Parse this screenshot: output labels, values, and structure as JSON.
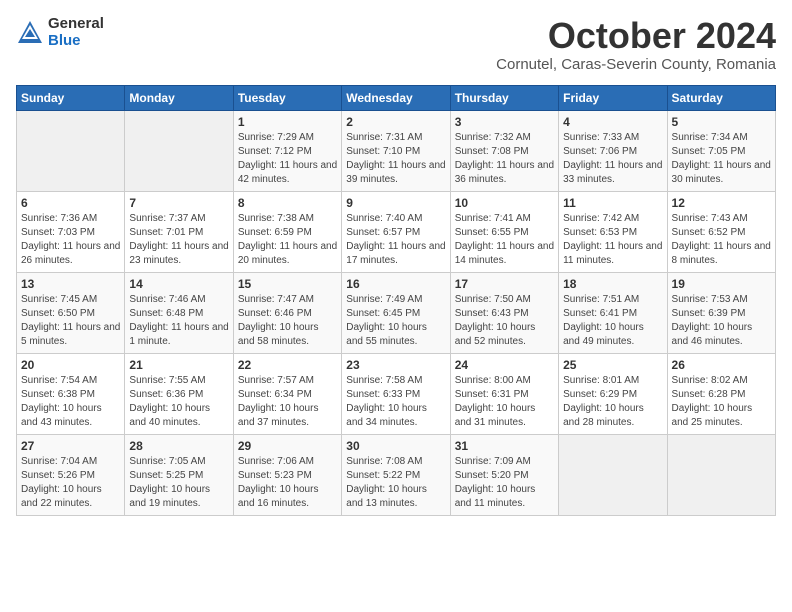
{
  "logo": {
    "general": "General",
    "blue": "Blue"
  },
  "title": {
    "month": "October 2024",
    "location": "Cornutel, Caras-Severin County, Romania"
  },
  "weekdays": [
    "Sunday",
    "Monday",
    "Tuesday",
    "Wednesday",
    "Thursday",
    "Friday",
    "Saturday"
  ],
  "weeks": [
    [
      {
        "day": "",
        "info": ""
      },
      {
        "day": "",
        "info": ""
      },
      {
        "day": "1",
        "info": "Sunrise: 7:29 AM\nSunset: 7:12 PM\nDaylight: 11 hours and 42 minutes."
      },
      {
        "day": "2",
        "info": "Sunrise: 7:31 AM\nSunset: 7:10 PM\nDaylight: 11 hours and 39 minutes."
      },
      {
        "day": "3",
        "info": "Sunrise: 7:32 AM\nSunset: 7:08 PM\nDaylight: 11 hours and 36 minutes."
      },
      {
        "day": "4",
        "info": "Sunrise: 7:33 AM\nSunset: 7:06 PM\nDaylight: 11 hours and 33 minutes."
      },
      {
        "day": "5",
        "info": "Sunrise: 7:34 AM\nSunset: 7:05 PM\nDaylight: 11 hours and 30 minutes."
      }
    ],
    [
      {
        "day": "6",
        "info": "Sunrise: 7:36 AM\nSunset: 7:03 PM\nDaylight: 11 hours and 26 minutes."
      },
      {
        "day": "7",
        "info": "Sunrise: 7:37 AM\nSunset: 7:01 PM\nDaylight: 11 hours and 23 minutes."
      },
      {
        "day": "8",
        "info": "Sunrise: 7:38 AM\nSunset: 6:59 PM\nDaylight: 11 hours and 20 minutes."
      },
      {
        "day": "9",
        "info": "Sunrise: 7:40 AM\nSunset: 6:57 PM\nDaylight: 11 hours and 17 minutes."
      },
      {
        "day": "10",
        "info": "Sunrise: 7:41 AM\nSunset: 6:55 PM\nDaylight: 11 hours and 14 minutes."
      },
      {
        "day": "11",
        "info": "Sunrise: 7:42 AM\nSunset: 6:53 PM\nDaylight: 11 hours and 11 minutes."
      },
      {
        "day": "12",
        "info": "Sunrise: 7:43 AM\nSunset: 6:52 PM\nDaylight: 11 hours and 8 minutes."
      }
    ],
    [
      {
        "day": "13",
        "info": "Sunrise: 7:45 AM\nSunset: 6:50 PM\nDaylight: 11 hours and 5 minutes."
      },
      {
        "day": "14",
        "info": "Sunrise: 7:46 AM\nSunset: 6:48 PM\nDaylight: 11 hours and 1 minute."
      },
      {
        "day": "15",
        "info": "Sunrise: 7:47 AM\nSunset: 6:46 PM\nDaylight: 10 hours and 58 minutes."
      },
      {
        "day": "16",
        "info": "Sunrise: 7:49 AM\nSunset: 6:45 PM\nDaylight: 10 hours and 55 minutes."
      },
      {
        "day": "17",
        "info": "Sunrise: 7:50 AM\nSunset: 6:43 PM\nDaylight: 10 hours and 52 minutes."
      },
      {
        "day": "18",
        "info": "Sunrise: 7:51 AM\nSunset: 6:41 PM\nDaylight: 10 hours and 49 minutes."
      },
      {
        "day": "19",
        "info": "Sunrise: 7:53 AM\nSunset: 6:39 PM\nDaylight: 10 hours and 46 minutes."
      }
    ],
    [
      {
        "day": "20",
        "info": "Sunrise: 7:54 AM\nSunset: 6:38 PM\nDaylight: 10 hours and 43 minutes."
      },
      {
        "day": "21",
        "info": "Sunrise: 7:55 AM\nSunset: 6:36 PM\nDaylight: 10 hours and 40 minutes."
      },
      {
        "day": "22",
        "info": "Sunrise: 7:57 AM\nSunset: 6:34 PM\nDaylight: 10 hours and 37 minutes."
      },
      {
        "day": "23",
        "info": "Sunrise: 7:58 AM\nSunset: 6:33 PM\nDaylight: 10 hours and 34 minutes."
      },
      {
        "day": "24",
        "info": "Sunrise: 8:00 AM\nSunset: 6:31 PM\nDaylight: 10 hours and 31 minutes."
      },
      {
        "day": "25",
        "info": "Sunrise: 8:01 AM\nSunset: 6:29 PM\nDaylight: 10 hours and 28 minutes."
      },
      {
        "day": "26",
        "info": "Sunrise: 8:02 AM\nSunset: 6:28 PM\nDaylight: 10 hours and 25 minutes."
      }
    ],
    [
      {
        "day": "27",
        "info": "Sunrise: 7:04 AM\nSunset: 5:26 PM\nDaylight: 10 hours and 22 minutes."
      },
      {
        "day": "28",
        "info": "Sunrise: 7:05 AM\nSunset: 5:25 PM\nDaylight: 10 hours and 19 minutes."
      },
      {
        "day": "29",
        "info": "Sunrise: 7:06 AM\nSunset: 5:23 PM\nDaylight: 10 hours and 16 minutes."
      },
      {
        "day": "30",
        "info": "Sunrise: 7:08 AM\nSunset: 5:22 PM\nDaylight: 10 hours and 13 minutes."
      },
      {
        "day": "31",
        "info": "Sunrise: 7:09 AM\nSunset: 5:20 PM\nDaylight: 10 hours and 11 minutes."
      },
      {
        "day": "",
        "info": ""
      },
      {
        "day": "",
        "info": ""
      }
    ]
  ]
}
